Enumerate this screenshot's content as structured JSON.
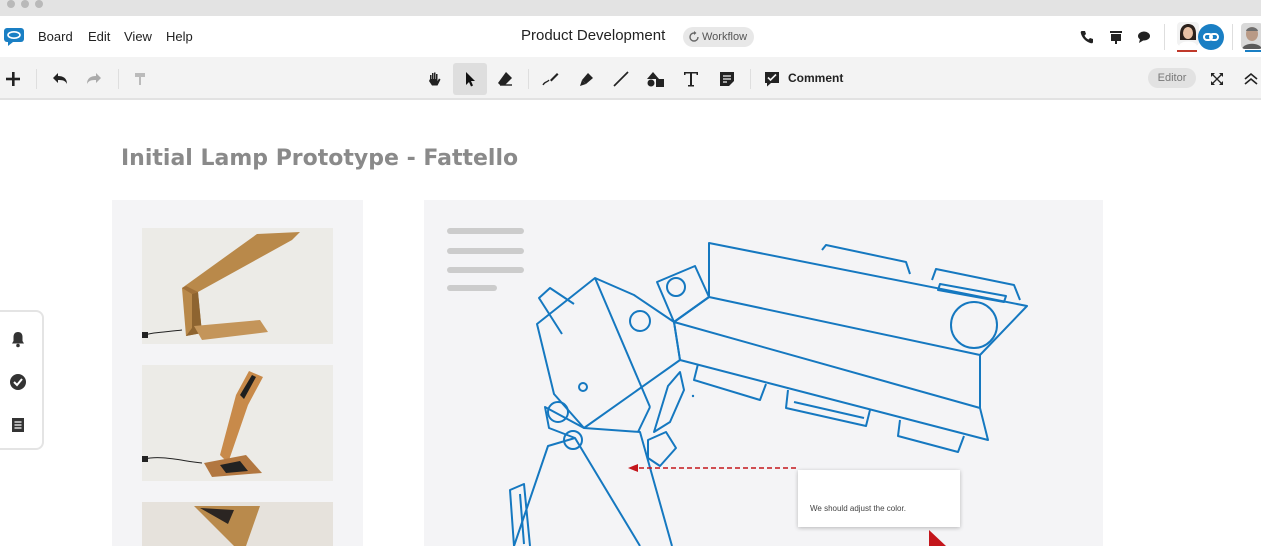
{
  "menu": {
    "items": [
      {
        "label": "Board"
      },
      {
        "label": "Edit"
      },
      {
        "label": "View"
      },
      {
        "label": "Help"
      }
    ]
  },
  "document": {
    "title": "Product Development",
    "workflow_label": "Workflow"
  },
  "header_icons": [
    "phone-icon",
    "presentation-icon",
    "chat-icon",
    "share-link-icon"
  ],
  "toolbar": {
    "tools": [
      "add-icon",
      "undo-icon",
      "redo-icon",
      "format-painter-icon",
      "pan-hand-icon",
      "select-pointer-icon",
      "eraser-icon",
      "pen-icon",
      "highlighter-icon",
      "line-icon",
      "shape-icon",
      "text-icon",
      "sticky-note-icon",
      "comment-icon"
    ],
    "active_tool": "select-pointer-icon",
    "comment_label": "Comment",
    "mode_label": "Editor"
  },
  "board": {
    "title": "Initial Lamp Prototype - Fattello",
    "comment_text": "We should adjust the color."
  },
  "side_dock": [
    "bell-icon",
    "check-circle-icon",
    "list-icon"
  ],
  "colors": {
    "accent": "#1a7fc4",
    "sketch_stroke": "#1578c0",
    "annotation": "#c4161c",
    "presence_red": "#c0392b"
  }
}
